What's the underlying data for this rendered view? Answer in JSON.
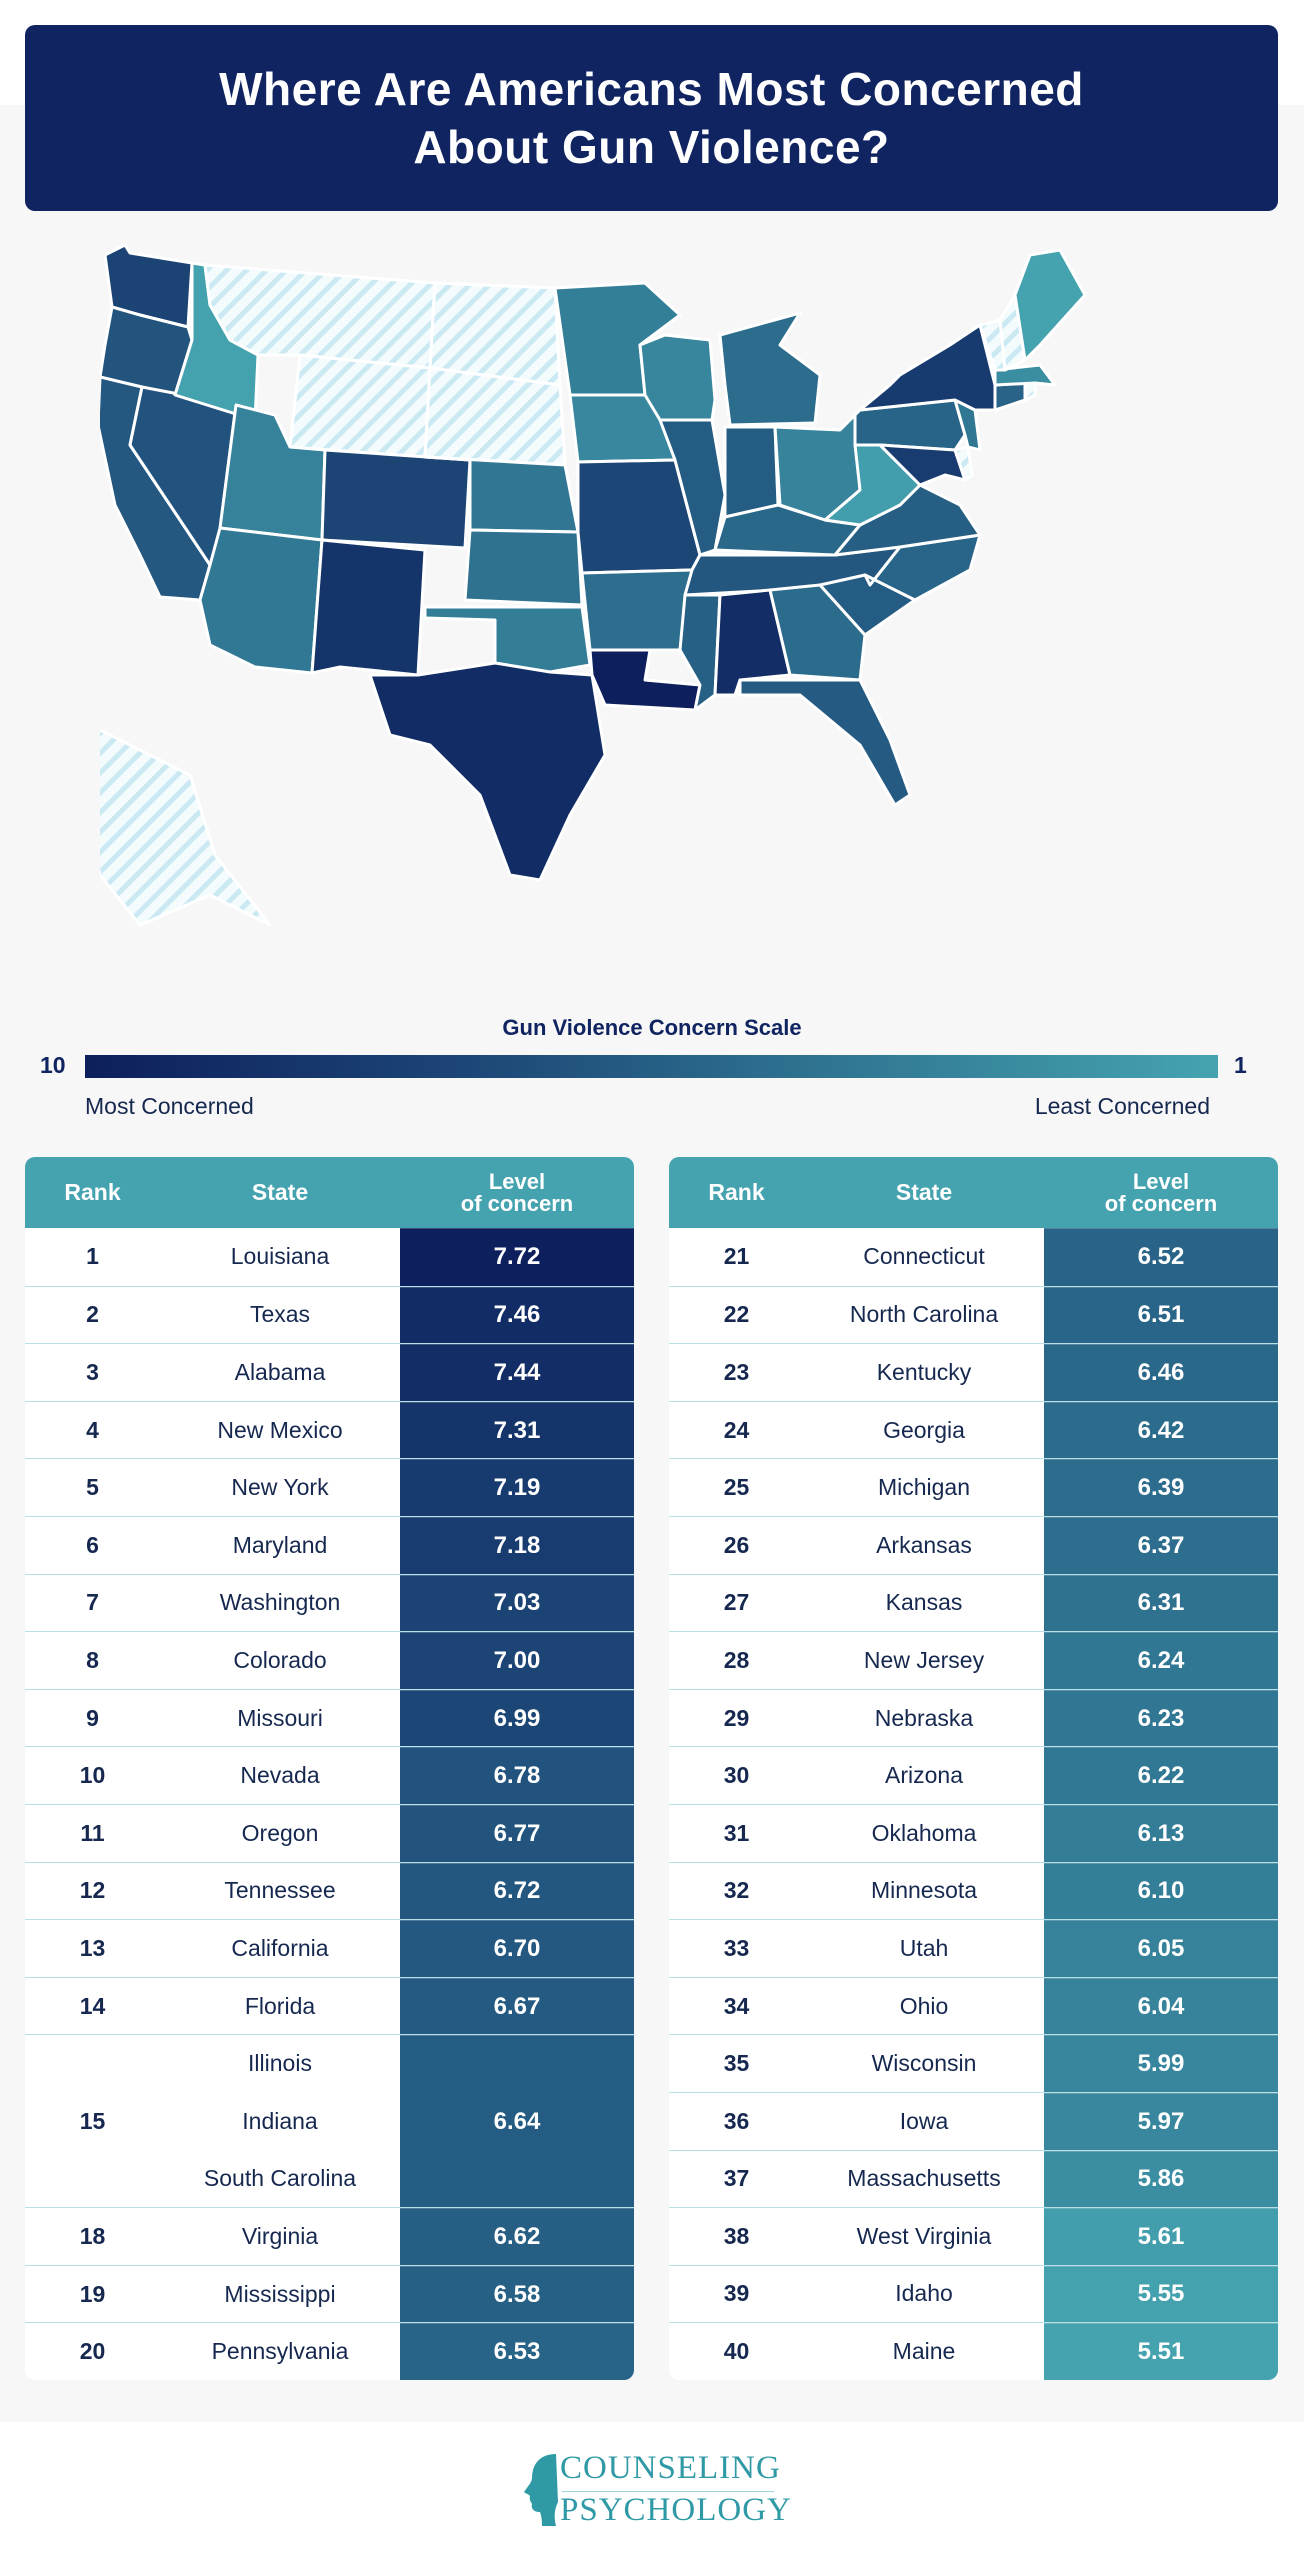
{
  "title": "Where Are Americans Most Concerned About Gun Violence?",
  "legend": {
    "title": "Gun Violence Concern Scale",
    "max_label": "10",
    "min_label": "1",
    "most_label": "Most Concerned",
    "least_label": "Least Concerned",
    "color_most": "#0d1f5c",
    "color_least": "#45a3b0",
    "no_data_pattern": "hatched light blue"
  },
  "table_headers": {
    "rank": "Rank",
    "state": "State",
    "level": "Level of concern"
  },
  "logo": {
    "line1": "COUNSELING",
    "line2": "PSYCHOLOGY"
  },
  "chart_data": {
    "type": "table",
    "title": "Where Are Americans Most Concerned About Gun Violence?",
    "scale": {
      "min": 1,
      "max": 10,
      "label": "Gun Violence Concern Scale"
    },
    "columns": [
      "Rank",
      "State",
      "Level of concern"
    ],
    "rows": [
      {
        "rank": "1",
        "states": [
          "Louisiana"
        ],
        "value": 7.72
      },
      {
        "rank": "2",
        "states": [
          "Texas"
        ],
        "value": 7.46
      },
      {
        "rank": "3",
        "states": [
          "Alabama"
        ],
        "value": 7.44
      },
      {
        "rank": "4",
        "states": [
          "New Mexico"
        ],
        "value": 7.31
      },
      {
        "rank": "5",
        "states": [
          "New York"
        ],
        "value": 7.19
      },
      {
        "rank": "6",
        "states": [
          "Maryland"
        ],
        "value": 7.18
      },
      {
        "rank": "7",
        "states": [
          "Washington"
        ],
        "value": 7.03
      },
      {
        "rank": "8",
        "states": [
          "Colorado"
        ],
        "value": 7.0
      },
      {
        "rank": "9",
        "states": [
          "Missouri"
        ],
        "value": 6.99
      },
      {
        "rank": "10",
        "states": [
          "Nevada"
        ],
        "value": 6.78
      },
      {
        "rank": "11",
        "states": [
          "Oregon"
        ],
        "value": 6.77
      },
      {
        "rank": "12",
        "states": [
          "Tennessee"
        ],
        "value": 6.72
      },
      {
        "rank": "13",
        "states": [
          "California"
        ],
        "value": 6.7
      },
      {
        "rank": "14",
        "states": [
          "Florida"
        ],
        "value": 6.67
      },
      {
        "rank": "15",
        "states": [
          "Illinois",
          "Indiana",
          "South Carolina"
        ],
        "value": 6.64
      },
      {
        "rank": "18",
        "states": [
          "Virginia"
        ],
        "value": 6.62
      },
      {
        "rank": "19",
        "states": [
          "Mississippi"
        ],
        "value": 6.58
      },
      {
        "rank": "20",
        "states": [
          "Pennsylvania"
        ],
        "value": 6.53
      },
      {
        "rank": "21",
        "states": [
          "Connecticut"
        ],
        "value": 6.52
      },
      {
        "rank": "22",
        "states": [
          "North Carolina"
        ],
        "value": 6.51
      },
      {
        "rank": "23",
        "states": [
          "Kentucky"
        ],
        "value": 6.46
      },
      {
        "rank": "24",
        "states": [
          "Georgia"
        ],
        "value": 6.42
      },
      {
        "rank": "25",
        "states": [
          "Michigan"
        ],
        "value": 6.39
      },
      {
        "rank": "26",
        "states": [
          "Arkansas"
        ],
        "value": 6.37
      },
      {
        "rank": "27",
        "states": [
          "Kansas"
        ],
        "value": 6.31
      },
      {
        "rank": "28",
        "states": [
          "New Jersey"
        ],
        "value": 6.24
      },
      {
        "rank": "29",
        "states": [
          "Nebraska"
        ],
        "value": 6.23
      },
      {
        "rank": "30",
        "states": [
          "Arizona"
        ],
        "value": 6.22
      },
      {
        "rank": "31",
        "states": [
          "Oklahoma"
        ],
        "value": 6.13
      },
      {
        "rank": "32",
        "states": [
          "Minnesota"
        ],
        "value": 6.1
      },
      {
        "rank": "33",
        "states": [
          "Utah"
        ],
        "value": 6.05
      },
      {
        "rank": "34",
        "states": [
          "Ohio"
        ],
        "value": 6.04
      },
      {
        "rank": "35",
        "states": [
          "Wisconsin"
        ],
        "value": 5.99
      },
      {
        "rank": "36",
        "states": [
          "Iowa"
        ],
        "value": 5.97
      },
      {
        "rank": "37",
        "states": [
          "Massachusetts"
        ],
        "value": 5.86
      },
      {
        "rank": "38",
        "states": [
          "West Virginia"
        ],
        "value": 5.61
      },
      {
        "rank": "39",
        "states": [
          "Idaho"
        ],
        "value": 5.55
      },
      {
        "rank": "40",
        "states": [
          "Maine"
        ],
        "value": 5.51
      }
    ],
    "no_data_states": [
      "Montana",
      "Wyoming",
      "North Dakota",
      "South Dakota",
      "Vermont",
      "New Hampshire",
      "Rhode Island",
      "Delaware",
      "Alaska"
    ]
  }
}
